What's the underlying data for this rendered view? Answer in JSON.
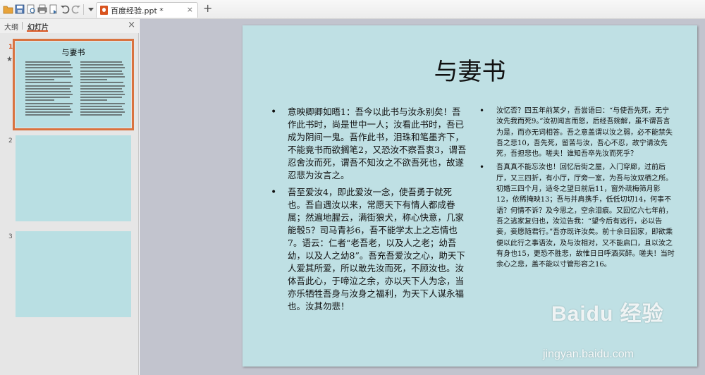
{
  "toolbar": {
    "icons": [
      "open-icon",
      "save-icon",
      "print-preview-icon",
      "print-icon",
      "export-icon",
      "undo-icon",
      "redo-icon",
      "dropdown-icon"
    ],
    "tab_label": "百度经验.ppt *",
    "tab_close": "×",
    "add_tab": "+"
  },
  "left_panel": {
    "tab_outline": "大纲",
    "tab_slides": "幻灯片",
    "close": "×",
    "thumbnails": [
      {
        "number": "1",
        "title": "与妻书"
      },
      {
        "number": "2"
      },
      {
        "number": "3"
      }
    ]
  },
  "slide": {
    "title": "与妻书",
    "left_paragraphs": [
      "意映卿卿如晤1：吾今以此书与汝永别矣！吾作此书时，尚是世中一人；汝看此书时，吾已成为阴间一鬼。吾作此书，泪珠和笔墨齐下，不能竟书而欲搁笔2，又恐汝不察吾衷3，谓吾忍舍汝而死，谓吾不知汝之不欲吾死也，故遂忍悲为汝言之。",
      "吾至爱汝4，即此爱汝一念，使吾勇于就死也。吾自遇汝以来，常愿天下有情人都成眷属；然遍地腥云，满街狼犬，称心快意，几家能彀5？司马青衫6，吾不能学太上之忘情也7。语云：仁者“老吾老，以及人之老；幼吾幼，以及人之幼8”。吾充吾爱汝之心，助天下人爱其所爱，所以敢先汝而死，不顾汝也。汝体吾此心，于啼泣之余，亦以天下人为念，当亦乐牺牲吾身与汝身之福利，为天下人谋永福也。汝其勿悲！"
    ],
    "right_paragraphs": [
      "汝忆否？四五年前某夕，吾尝语曰：“与使吾先死，无宁汝先我而死9。”汝初闻言而怒，后经吾婉解，虽不谓吾言为是，而亦无词相答。吾之意盖谓以汝之弱，必不能禁失吾之悲10，吾先死，留苦与汝，吾心不忍，故宁请汝先死，吾担悲也。嗟夫！谁知吾卒先汝而死乎？",
      "吾真真不能忘汝也！回忆后街之屋，入门穿廊，过前后厅，又三四折，有小厅，厅旁一室，为吾与汝双栖之所。初婚三四个月，适冬之望日前后11，窗外疏梅筛月影12，依稀掩映13；吾与并肩携手，低低切切14，何事不语？何情不诉？及今思之，空余泪痕。又回忆六七年前，吾之逃家复归也，汝泣告我：“望今后有远行，必以告妾，妾愿随君行。”吾亦既许汝矣。前十余日回家，即欲乘便以此行之事语汝，及与汝相对，又不能启口，且以汝之有身也15，更恐不胜悲，故惟日日呼酒买醉。嗟夫！当时余心之悲，盖不能以寸管形容之16。"
    ],
    "bullet": "•"
  },
  "watermark": {
    "brand": "Baidu 经验",
    "url": "jingyan.baidu.com"
  }
}
